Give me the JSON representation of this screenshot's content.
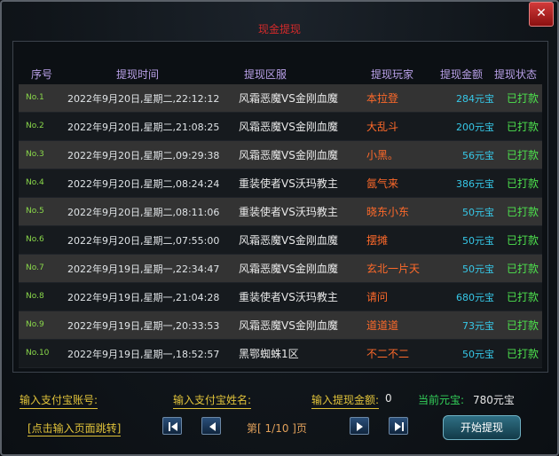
{
  "title": "现金提现",
  "close_label": "✕",
  "columns": [
    "序号",
    "提现时间",
    "提现区服",
    "提现玩家",
    "提现金额",
    "提现状态"
  ],
  "rows": [
    {
      "no": "No.1",
      "time": "2022年9月20日,星期二,22:12:12",
      "server": "风霜恶魔VS金刚血魔",
      "player": "本拉登",
      "amount": "284元宝",
      "status": "已打款"
    },
    {
      "no": "No.2",
      "time": "2022年9月20日,星期二,21:08:25",
      "server": "风霜恶魔VS金刚血魔",
      "player": "大乱斗",
      "amount": "200元宝",
      "status": "已打款"
    },
    {
      "no": "No.3",
      "time": "2022年9月20日,星期二,09:29:38",
      "server": "风霜恶魔VS金刚血魔",
      "player": "小黑。",
      "amount": "56元宝",
      "status": "已打款"
    },
    {
      "no": "No.4",
      "time": "2022年9月20日,星期二,08:24:24",
      "server": "重装使者VS沃玛教主",
      "player": "氤气来",
      "amount": "386元宝",
      "status": "已打款"
    },
    {
      "no": "No.5",
      "time": "2022年9月20日,星期二,08:11:06",
      "server": "重装使者VS沃玛教主",
      "player": "晓东小东",
      "amount": "50元宝",
      "status": "已打款"
    },
    {
      "no": "No.6",
      "time": "2022年9月20日,星期二,07:55:00",
      "server": "风霜恶魔VS金刚血魔",
      "player": "摆摊",
      "amount": "50元宝",
      "status": "已打款"
    },
    {
      "no": "No.7",
      "time": "2022年9月19日,星期一,22:34:47",
      "server": "风霜恶魔VS金刚血魔",
      "player": "玄北一片天",
      "amount": "50元宝",
      "status": "已打款"
    },
    {
      "no": "No.8",
      "time": "2022年9月19日,星期一,21:04:28",
      "server": "重装使者VS沃玛教主",
      "player": "请问",
      "amount": "680元宝",
      "status": "已打款"
    },
    {
      "no": "No.9",
      "time": "2022年9月19日,星期一,20:33:53",
      "server": "风霜恶魔VS金刚血魔",
      "player": "道道道",
      "amount": "73元宝",
      "status": "已打款"
    },
    {
      "no": "No.10",
      "time": "2022年9月19日,星期一,18:52:57",
      "server": "黑鄂蜘蛛1区",
      "player": "不二不二",
      "amount": "50元宝",
      "status": "已打款"
    }
  ],
  "footer": {
    "account_label": "输入支付宝账号:",
    "name_label": "输入支付宝姓名:",
    "amount_label": "输入提现金额:",
    "amount_value": "0",
    "balance_label": "当前元宝:",
    "balance_value": "780元宝",
    "jump_link": "[点击输入页面跳转]",
    "page_prefix": "第[",
    "page_value": "1/10",
    "page_suffix": "]页",
    "start_button": "开始提现"
  },
  "colors": {
    "title": "#d42a2a",
    "header_text": "#b9a0e8",
    "row_no": "#8ad84a",
    "player": "#ff6a2a",
    "amount": "#36c8e8",
    "status": "#4de14d",
    "footer_label": "#e0c23a",
    "balance_label": "#33d15a"
  },
  "icons": [
    "close-icon",
    "first-page-icon",
    "prev-page-icon",
    "next-page-icon",
    "last-page-icon"
  ]
}
